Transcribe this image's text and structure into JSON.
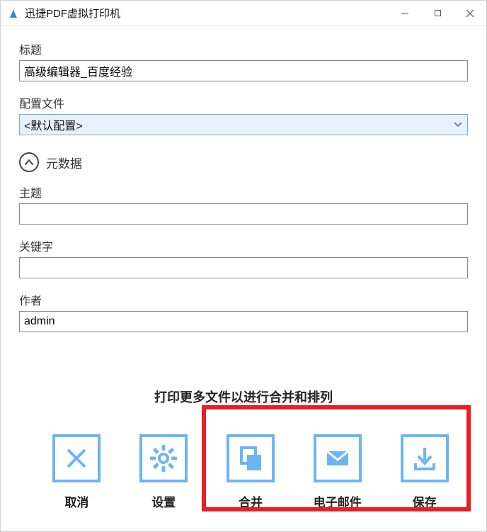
{
  "window": {
    "title": "迅捷PDF虚拟打印机"
  },
  "labels": {
    "title_field": "标题",
    "config_field": "配置文件",
    "metadata_toggle": "元数据",
    "subject_field": "主题",
    "keywords_field": "关键字",
    "author_field": "作者"
  },
  "values": {
    "title_input": "高级编辑器_百度经验",
    "config_select": "<默认配置>",
    "subject_input": "",
    "keywords_input": "",
    "author_input": "admin"
  },
  "hint": "打印更多文件以进行合并和排列",
  "actions": {
    "cancel": "取消",
    "settings": "设置",
    "merge": "合并",
    "email": "电子邮件",
    "save": "保存"
  }
}
